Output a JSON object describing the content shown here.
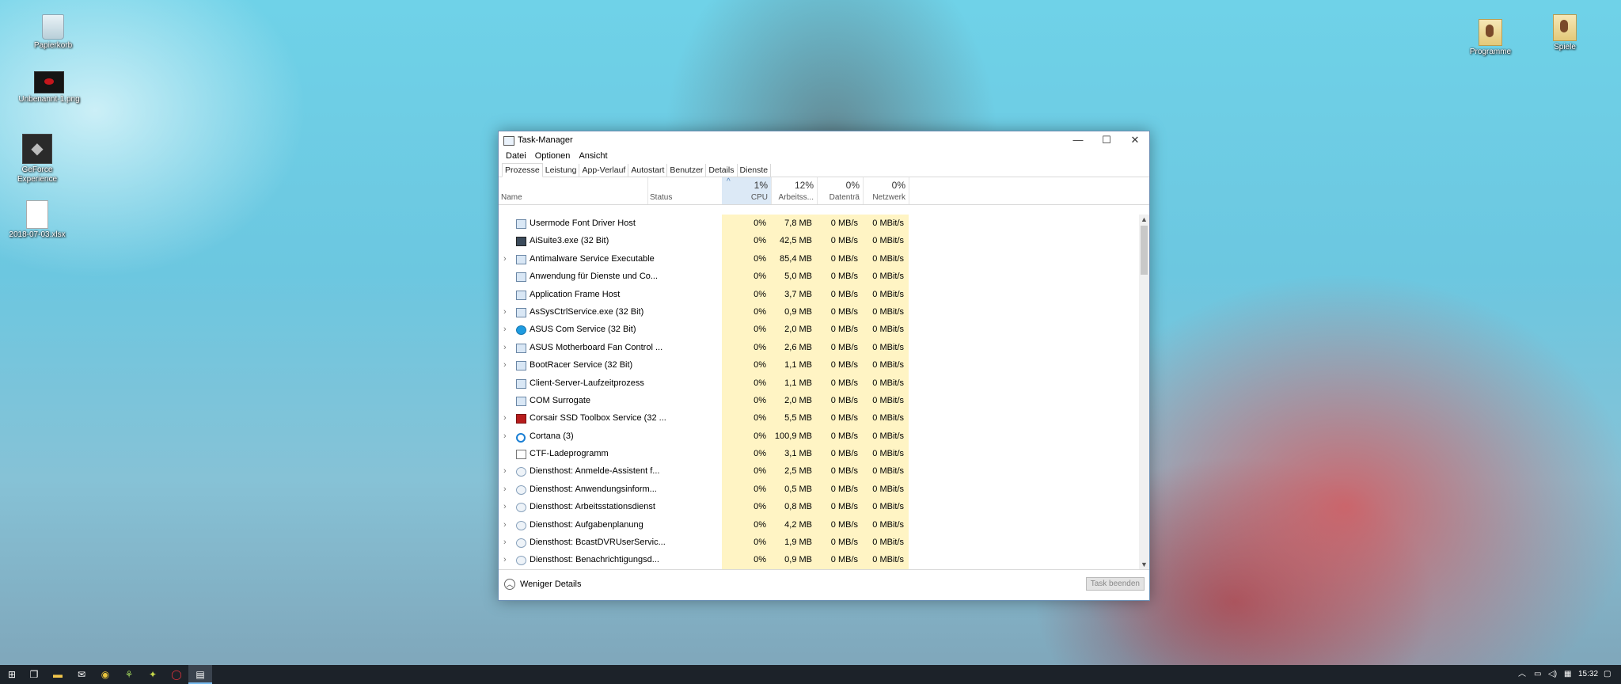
{
  "desktop": {
    "icons_left": [
      {
        "label": "Papierkorb",
        "icon": "recycle-bin-icon"
      },
      {
        "label": "Unbenannt-1.png",
        "icon": "image-file-icon"
      },
      {
        "label": "GeForce Experience",
        "icon": "geforce-experience-icon"
      },
      {
        "label": "2018-07-03.xlsx",
        "icon": "document-icon"
      }
    ],
    "icons_right": [
      {
        "label": "Programme",
        "icon": "folder-icon"
      },
      {
        "label": "Spiele",
        "icon": "folder-icon"
      }
    ]
  },
  "window": {
    "title": "Task-Manager",
    "controls": {
      "minimize": "—",
      "maximize": "☐",
      "close": "✕"
    },
    "menu": [
      "Datei",
      "Optionen",
      "Ansicht"
    ],
    "tabs": [
      "Prozesse",
      "Leistung",
      "App-Verlauf",
      "Autostart",
      "Benutzer",
      "Details",
      "Dienste"
    ],
    "active_tab": "Prozesse",
    "columns": {
      "name": "Name",
      "status": "Status",
      "cpu": {
        "percent": "1%",
        "label": "CPU"
      },
      "memory": {
        "percent": "12%",
        "label": "Arbeitss..."
      },
      "disk": {
        "percent": "0%",
        "label": "Datenträ"
      },
      "network": {
        "percent": "0%",
        "label": "Netzwerk"
      }
    },
    "processes": [
      {
        "name": "Usermode Font Driver Host",
        "expand": "",
        "icon": "box",
        "status": "",
        "cpu": "0%",
        "mem": "7,8 MB",
        "disk": "0 MB/s",
        "net": "0 MBit/s"
      },
      {
        "name": "AiSuite3.exe (32 Bit)",
        "expand": "",
        "icon": "dark",
        "status": "",
        "cpu": "0%",
        "mem": "42,5 MB",
        "disk": "0 MB/s",
        "net": "0 MBit/s"
      },
      {
        "name": "Antimalware Service Executable",
        "expand": "›",
        "icon": "box",
        "status": "",
        "cpu": "0%",
        "mem": "85,4 MB",
        "disk": "0 MB/s",
        "net": "0 MBit/s"
      },
      {
        "name": "Anwendung für Dienste und Co...",
        "expand": "",
        "icon": "box",
        "status": "",
        "cpu": "0%",
        "mem": "5,0 MB",
        "disk": "0 MB/s",
        "net": "0 MBit/s"
      },
      {
        "name": "Application Frame Host",
        "expand": "",
        "icon": "box",
        "status": "",
        "cpu": "0%",
        "mem": "3,7 MB",
        "disk": "0 MB/s",
        "net": "0 MBit/s"
      },
      {
        "name": "AsSysCtrlService.exe (32 Bit)",
        "expand": "›",
        "icon": "box",
        "status": "",
        "cpu": "0%",
        "mem": "0,9 MB",
        "disk": "0 MB/s",
        "net": "0 MBit/s"
      },
      {
        "name": "ASUS Com Service (32 Bit)",
        "expand": "›",
        "icon": "asus",
        "status": "",
        "cpu": "0%",
        "mem": "2,0 MB",
        "disk": "0 MB/s",
        "net": "0 MBit/s"
      },
      {
        "name": "ASUS Motherboard Fan Control ...",
        "expand": "›",
        "icon": "box",
        "status": "",
        "cpu": "0%",
        "mem": "2,6 MB",
        "disk": "0 MB/s",
        "net": "0 MBit/s"
      },
      {
        "name": "BootRacer Service (32 Bit)",
        "expand": "›",
        "icon": "box",
        "status": "",
        "cpu": "0%",
        "mem": "1,1 MB",
        "disk": "0 MB/s",
        "net": "0 MBit/s"
      },
      {
        "name": "Client-Server-Laufzeitprozess",
        "expand": "",
        "icon": "box",
        "status": "",
        "cpu": "0%",
        "mem": "1,1 MB",
        "disk": "0 MB/s",
        "net": "0 MBit/s"
      },
      {
        "name": "COM Surrogate",
        "expand": "",
        "icon": "box",
        "status": "",
        "cpu": "0%",
        "mem": "2,0 MB",
        "disk": "0 MB/s",
        "net": "0 MBit/s"
      },
      {
        "name": "Corsair SSD Toolbox Service (32 ...",
        "expand": "›",
        "icon": "red",
        "status": "",
        "cpu": "0%",
        "mem": "5,5 MB",
        "disk": "0 MB/s",
        "net": "0 MBit/s"
      },
      {
        "name": "Cortana (3)",
        "expand": "›",
        "icon": "circle",
        "status": "",
        "suspended": true,
        "cpu": "0%",
        "mem": "100,9 MB",
        "disk": "0 MB/s",
        "net": "0 MBit/s"
      },
      {
        "name": "CTF-Ladeprogramm",
        "expand": "",
        "icon": "pen",
        "status": "",
        "cpu": "0%",
        "mem": "3,1 MB",
        "disk": "0 MB/s",
        "net": "0 MBit/s"
      },
      {
        "name": "Diensthost: Anmelde-Assistent f...",
        "expand": "›",
        "icon": "gear",
        "status": "",
        "cpu": "0%",
        "mem": "2,5 MB",
        "disk": "0 MB/s",
        "net": "0 MBit/s"
      },
      {
        "name": "Diensthost: Anwendungsinform...",
        "expand": "›",
        "icon": "gear",
        "status": "",
        "cpu": "0%",
        "mem": "0,5 MB",
        "disk": "0 MB/s",
        "net": "0 MBit/s"
      },
      {
        "name": "Diensthost: Arbeitsstationsdienst",
        "expand": "›",
        "icon": "gear",
        "status": "",
        "cpu": "0%",
        "mem": "0,8 MB",
        "disk": "0 MB/s",
        "net": "0 MBit/s"
      },
      {
        "name": "Diensthost: Aufgabenplanung",
        "expand": "›",
        "icon": "gear",
        "status": "",
        "cpu": "0%",
        "mem": "4,2 MB",
        "disk": "0 MB/s",
        "net": "0 MBit/s"
      },
      {
        "name": "Diensthost: BcastDVRUserServic...",
        "expand": "›",
        "icon": "gear",
        "status": "",
        "cpu": "0%",
        "mem": "1,9 MB",
        "disk": "0 MB/s",
        "net": "0 MBit/s"
      },
      {
        "name": "Diensthost: Benachrichtigungsd...",
        "expand": "›",
        "icon": "gear",
        "status": "",
        "cpu": "0%",
        "mem": "0,9 MB",
        "disk": "0 MB/s",
        "net": "0 MBit/s"
      }
    ],
    "footer": {
      "less_details": "Weniger Details",
      "end_task": "Task beenden"
    }
  },
  "taskbar": {
    "clock": "15:32",
    "pinned": [
      "start-icon",
      "task-view-icon",
      "explorer-icon",
      "mail-icon",
      "chrome-icon",
      "app-icon",
      "app-icon",
      "opera-icon",
      "task-manager-icon"
    ]
  }
}
